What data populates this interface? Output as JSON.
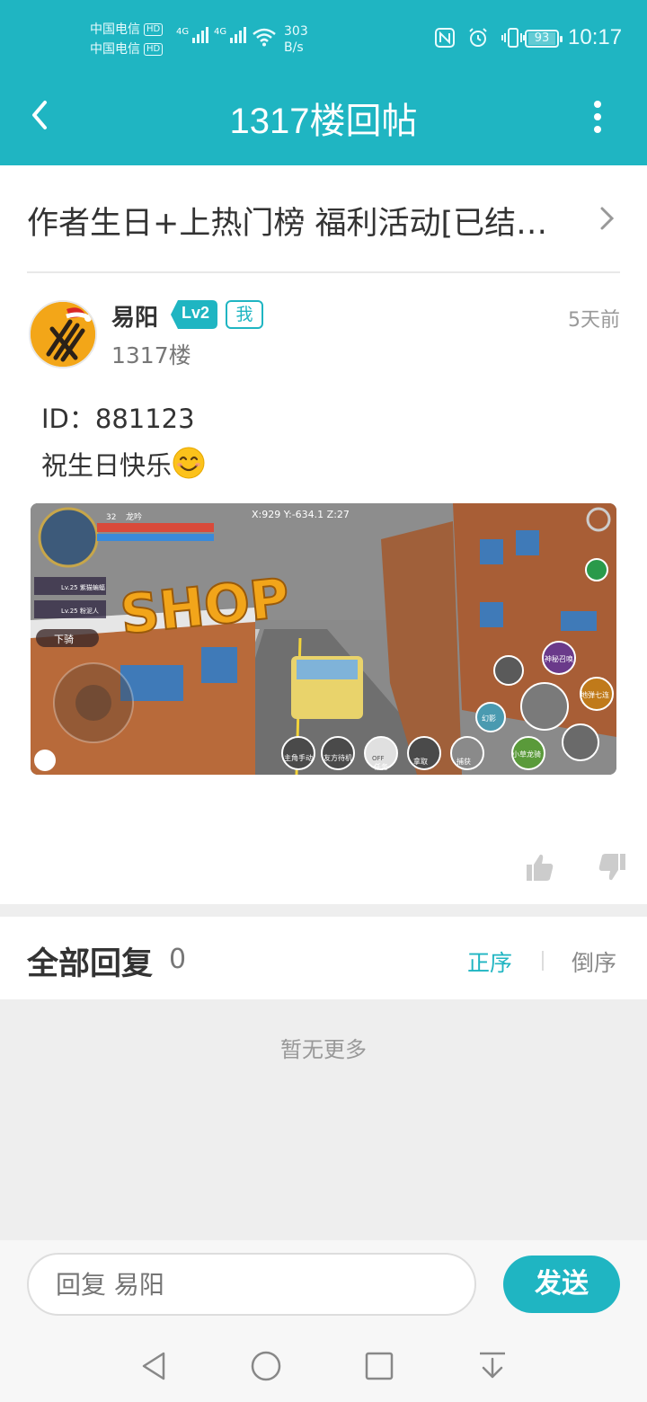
{
  "status_bar": {
    "carrier1": "中国电信",
    "carrier2": "中国电信",
    "hd": "HD",
    "net1": "4G",
    "net2": "4G",
    "speed_value": "303",
    "speed_unit": "B/s",
    "battery": "93",
    "time": "10:17"
  },
  "header": {
    "title": "1317楼回帖"
  },
  "thread": {
    "title": "作者生日+上热门榜 福利活动[已结束]"
  },
  "post": {
    "author": "易阳",
    "level": "Lv2",
    "me_badge": "我",
    "floor": "1317楼",
    "time": "5天前",
    "line1": "ID：881123",
    "line2": "祝生日快乐"
  },
  "screenshot_image": {
    "hud_coords": "X:929   Y:-634.1   Z:27",
    "player_level": "32",
    "player_name": "龙吟",
    "pet1": "Lv.25  紫猫蝙蝠",
    "pet2": "Lv.25  粉泥人",
    "dismount": "下骑",
    "shop_sign": "SHOP",
    "skill_summon": "神秘召唤",
    "skill_seven": "地弹七连",
    "skill_illusion": "幻影",
    "btn_protagonist": "主角手动",
    "btn_friend": "友方待机",
    "btn_task": "任务",
    "btn_off": "OFF",
    "btn_take": "拿取",
    "btn_capture": "捕获",
    "btn_dragon": "小草龙骑"
  },
  "replies": {
    "title": "全部回复",
    "count": "0",
    "sort_asc": "正序",
    "sort_desc": "倒序",
    "empty": "暂无更多"
  },
  "reply_input": {
    "placeholder": "回复 易阳",
    "send": "发送"
  },
  "colors": {
    "accent": "#1fb5c2",
    "background_gray": "#eeeeee"
  }
}
